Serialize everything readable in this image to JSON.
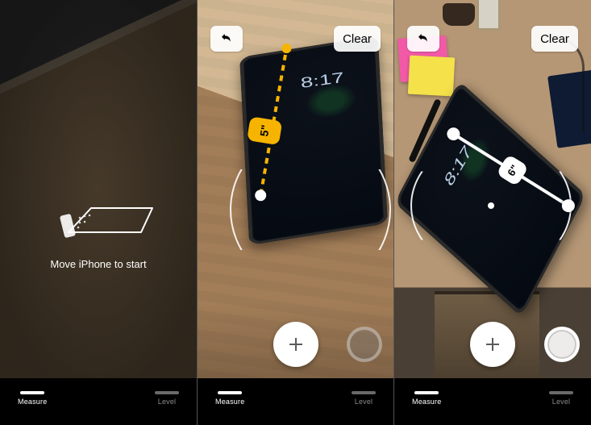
{
  "app": {
    "name": "Measure"
  },
  "tabs": {
    "measure": "Measure",
    "level": "Level"
  },
  "buttons": {
    "undo_aria": "Undo",
    "clear": "Clear",
    "add_aria": "Add point",
    "shutter_aria": "Capture"
  },
  "screen1": {
    "instruction": "Move iPhone to start"
  },
  "screen2": {
    "measurement": {
      "value": "5",
      "unit": "in",
      "display": "5\"",
      "state": "in-progress"
    },
    "target_device_clock": "8:17"
  },
  "screen3": {
    "measurement": {
      "value": "6",
      "unit": "in",
      "display": "6\"",
      "state": "committed"
    },
    "target_device_clock": "8:17"
  }
}
